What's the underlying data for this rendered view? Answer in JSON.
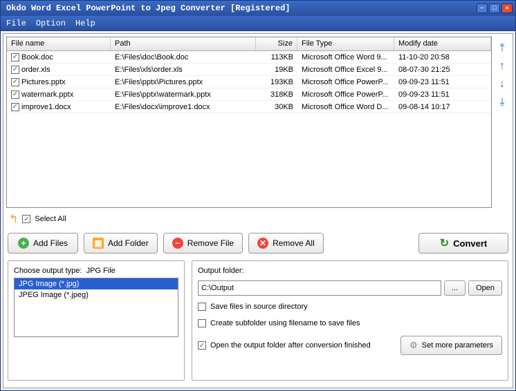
{
  "title": "Okdo Word Excel PowerPoint to Jpeg Converter [Registered]",
  "menu": {
    "file": "File",
    "option": "Option",
    "help": "Help"
  },
  "grid": {
    "headers": {
      "name": "File name",
      "path": "Path",
      "size": "Size",
      "type": "File Type",
      "date": "Modify date"
    },
    "rows": [
      {
        "checked": true,
        "name": "Book.doc",
        "path": "E:\\Files\\doc\\Book.doc",
        "size": "113KB",
        "type": "Microsoft Office Word 9...",
        "date": "11-10-20 20:58"
      },
      {
        "checked": true,
        "name": "order.xls",
        "path": "E:\\Files\\xls\\order.xls",
        "size": "19KB",
        "type": "Microsoft Office Excel 9...",
        "date": "08-07-30 21:25"
      },
      {
        "checked": true,
        "name": "Pictures.pptx",
        "path": "E:\\Files\\pptx\\Pictures.pptx",
        "size": "193KB",
        "type": "Microsoft Office PowerP...",
        "date": "09-09-23 11:51"
      },
      {
        "checked": true,
        "name": "watermark.pptx",
        "path": "E:\\Files\\pptx\\watermark.pptx",
        "size": "318KB",
        "type": "Microsoft Office PowerP...",
        "date": "09-09-23 11:51"
      },
      {
        "checked": true,
        "name": "improve1.docx",
        "path": "E:\\Files\\docx\\improve1.docx",
        "size": "30KB",
        "type": "Microsoft Office Word D...",
        "date": "09-08-14 10:17"
      }
    ]
  },
  "selectAll": {
    "label": "Select All",
    "checked": true
  },
  "buttons": {
    "addFiles": "Add Files",
    "addFolder": "Add Folder",
    "removeFile": "Remove File",
    "removeAll": "Remove All",
    "convert": "Convert"
  },
  "outputType": {
    "label": "Choose output type:",
    "current": "JPG File",
    "options": [
      {
        "label": "JPG Image (*.jpg)",
        "selected": true
      },
      {
        "label": "JPEG Image (*.jpeg)",
        "selected": false
      }
    ]
  },
  "outputFolder": {
    "label": "Output folder:",
    "value": "C:\\Output",
    "browse": "...",
    "open": "Open"
  },
  "checks": {
    "saveSource": {
      "label": "Save files in source directory",
      "checked": false
    },
    "subfolder": {
      "label": "Create subfolder using filename to save files",
      "checked": false
    },
    "openAfter": {
      "label": "Open the output folder after conversion finished",
      "checked": true
    }
  },
  "params": "Set more parameters"
}
